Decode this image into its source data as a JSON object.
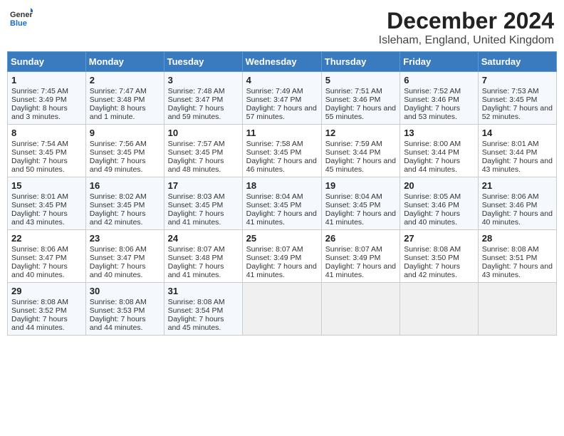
{
  "header": {
    "logo_line1": "General",
    "logo_line2": "Blue",
    "title": "December 2024",
    "subtitle": "Isleham, England, United Kingdom"
  },
  "days_of_week": [
    "Sunday",
    "Monday",
    "Tuesday",
    "Wednesday",
    "Thursday",
    "Friday",
    "Saturday"
  ],
  "weeks": [
    [
      {
        "day": "1",
        "sunrise": "Sunrise: 7:45 AM",
        "sunset": "Sunset: 3:49 PM",
        "daylight": "Daylight: 8 hours and 3 minutes."
      },
      {
        "day": "2",
        "sunrise": "Sunrise: 7:47 AM",
        "sunset": "Sunset: 3:48 PM",
        "daylight": "Daylight: 8 hours and 1 minute."
      },
      {
        "day": "3",
        "sunrise": "Sunrise: 7:48 AM",
        "sunset": "Sunset: 3:47 PM",
        "daylight": "Daylight: 7 hours and 59 minutes."
      },
      {
        "day": "4",
        "sunrise": "Sunrise: 7:49 AM",
        "sunset": "Sunset: 3:47 PM",
        "daylight": "Daylight: 7 hours and 57 minutes."
      },
      {
        "day": "5",
        "sunrise": "Sunrise: 7:51 AM",
        "sunset": "Sunset: 3:46 PM",
        "daylight": "Daylight: 7 hours and 55 minutes."
      },
      {
        "day": "6",
        "sunrise": "Sunrise: 7:52 AM",
        "sunset": "Sunset: 3:46 PM",
        "daylight": "Daylight: 7 hours and 53 minutes."
      },
      {
        "day": "7",
        "sunrise": "Sunrise: 7:53 AM",
        "sunset": "Sunset: 3:45 PM",
        "daylight": "Daylight: 7 hours and 52 minutes."
      }
    ],
    [
      {
        "day": "8",
        "sunrise": "Sunrise: 7:54 AM",
        "sunset": "Sunset: 3:45 PM",
        "daylight": "Daylight: 7 hours and 50 minutes."
      },
      {
        "day": "9",
        "sunrise": "Sunrise: 7:56 AM",
        "sunset": "Sunset: 3:45 PM",
        "daylight": "Daylight: 7 hours and 49 minutes."
      },
      {
        "day": "10",
        "sunrise": "Sunrise: 7:57 AM",
        "sunset": "Sunset: 3:45 PM",
        "daylight": "Daylight: 7 hours and 48 minutes."
      },
      {
        "day": "11",
        "sunrise": "Sunrise: 7:58 AM",
        "sunset": "Sunset: 3:45 PM",
        "daylight": "Daylight: 7 hours and 46 minutes."
      },
      {
        "day": "12",
        "sunrise": "Sunrise: 7:59 AM",
        "sunset": "Sunset: 3:44 PM",
        "daylight": "Daylight: 7 hours and 45 minutes."
      },
      {
        "day": "13",
        "sunrise": "Sunrise: 8:00 AM",
        "sunset": "Sunset: 3:44 PM",
        "daylight": "Daylight: 7 hours and 44 minutes."
      },
      {
        "day": "14",
        "sunrise": "Sunrise: 8:01 AM",
        "sunset": "Sunset: 3:44 PM",
        "daylight": "Daylight: 7 hours and 43 minutes."
      }
    ],
    [
      {
        "day": "15",
        "sunrise": "Sunrise: 8:01 AM",
        "sunset": "Sunset: 3:45 PM",
        "daylight": "Daylight: 7 hours and 43 minutes."
      },
      {
        "day": "16",
        "sunrise": "Sunrise: 8:02 AM",
        "sunset": "Sunset: 3:45 PM",
        "daylight": "Daylight: 7 hours and 42 minutes."
      },
      {
        "day": "17",
        "sunrise": "Sunrise: 8:03 AM",
        "sunset": "Sunset: 3:45 PM",
        "daylight": "Daylight: 7 hours and 41 minutes."
      },
      {
        "day": "18",
        "sunrise": "Sunrise: 8:04 AM",
        "sunset": "Sunset: 3:45 PM",
        "daylight": "Daylight: 7 hours and 41 minutes."
      },
      {
        "day": "19",
        "sunrise": "Sunrise: 8:04 AM",
        "sunset": "Sunset: 3:45 PM",
        "daylight": "Daylight: 7 hours and 41 minutes."
      },
      {
        "day": "20",
        "sunrise": "Sunrise: 8:05 AM",
        "sunset": "Sunset: 3:46 PM",
        "daylight": "Daylight: 7 hours and 40 minutes."
      },
      {
        "day": "21",
        "sunrise": "Sunrise: 8:06 AM",
        "sunset": "Sunset: 3:46 PM",
        "daylight": "Daylight: 7 hours and 40 minutes."
      }
    ],
    [
      {
        "day": "22",
        "sunrise": "Sunrise: 8:06 AM",
        "sunset": "Sunset: 3:47 PM",
        "daylight": "Daylight: 7 hours and 40 minutes."
      },
      {
        "day": "23",
        "sunrise": "Sunrise: 8:06 AM",
        "sunset": "Sunset: 3:47 PM",
        "daylight": "Daylight: 7 hours and 40 minutes."
      },
      {
        "day": "24",
        "sunrise": "Sunrise: 8:07 AM",
        "sunset": "Sunset: 3:48 PM",
        "daylight": "Daylight: 7 hours and 41 minutes."
      },
      {
        "day": "25",
        "sunrise": "Sunrise: 8:07 AM",
        "sunset": "Sunset: 3:49 PM",
        "daylight": "Daylight: 7 hours and 41 minutes."
      },
      {
        "day": "26",
        "sunrise": "Sunrise: 8:07 AM",
        "sunset": "Sunset: 3:49 PM",
        "daylight": "Daylight: 7 hours and 41 minutes."
      },
      {
        "day": "27",
        "sunrise": "Sunrise: 8:08 AM",
        "sunset": "Sunset: 3:50 PM",
        "daylight": "Daylight: 7 hours and 42 minutes."
      },
      {
        "day": "28",
        "sunrise": "Sunrise: 8:08 AM",
        "sunset": "Sunset: 3:51 PM",
        "daylight": "Daylight: 7 hours and 43 minutes."
      }
    ],
    [
      {
        "day": "29",
        "sunrise": "Sunrise: 8:08 AM",
        "sunset": "Sunset: 3:52 PM",
        "daylight": "Daylight: 7 hours and 44 minutes."
      },
      {
        "day": "30",
        "sunrise": "Sunrise: 8:08 AM",
        "sunset": "Sunset: 3:53 PM",
        "daylight": "Daylight: 7 hours and 44 minutes."
      },
      {
        "day": "31",
        "sunrise": "Sunrise: 8:08 AM",
        "sunset": "Sunset: 3:54 PM",
        "daylight": "Daylight: 7 hours and 45 minutes."
      },
      null,
      null,
      null,
      null
    ]
  ]
}
